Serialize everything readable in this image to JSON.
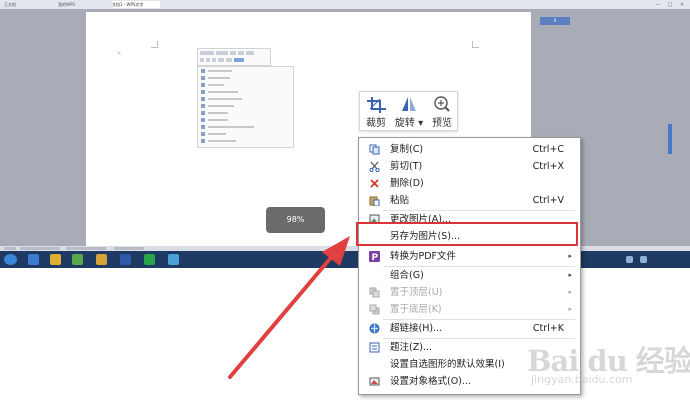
{
  "window": {
    "tabs": [
      "正文档",
      "我的WPS",
      "文档1 - WPS文字"
    ],
    "controls": [
      "—",
      "□",
      "✕"
    ]
  },
  "document": {
    "zoom_indicator": "98%"
  },
  "side_tag": "4",
  "picture_toolbar": {
    "items": [
      {
        "label": "裁剪",
        "icon": "crop-icon"
      },
      {
        "label": "旋转 ▾",
        "icon": "rotate-icon"
      },
      {
        "label": "预览",
        "icon": "zoom-preview-icon"
      }
    ]
  },
  "context_menu": {
    "items": [
      {
        "label": "复制(C)",
        "shortcut": "Ctrl+C",
        "icon": "copy-icon",
        "disabled": false,
        "submenu": false
      },
      {
        "label": "剪切(T)",
        "shortcut": "Ctrl+X",
        "icon": "scissors-icon",
        "disabled": false,
        "submenu": false
      },
      {
        "label": "删除(D)",
        "shortcut": "",
        "icon": "delete-icon",
        "disabled": false,
        "submenu": false
      },
      {
        "label": "粘贴",
        "shortcut": "Ctrl+V",
        "icon": "paste-icon",
        "disabled": false,
        "submenu": false
      },
      {
        "label": "更改图片(A)...",
        "shortcut": "",
        "icon": "change-picture-icon",
        "disabled": false,
        "submenu": false
      },
      {
        "label": "另存为图片(S)...",
        "shortcut": "",
        "icon": "",
        "disabled": false,
        "submenu": false
      },
      {
        "label": "转换为PDF文件",
        "shortcut": "",
        "icon": "pdf-icon",
        "disabled": false,
        "submenu": true
      },
      {
        "label": "组合(G)",
        "shortcut": "",
        "icon": "",
        "disabled": false,
        "submenu": true
      },
      {
        "label": "置于顶层(U)",
        "shortcut": "",
        "icon": "bring-to-front-icon",
        "disabled": true,
        "submenu": true
      },
      {
        "label": "置于底层(K)",
        "shortcut": "",
        "icon": "send-to-back-icon",
        "disabled": true,
        "submenu": true
      },
      {
        "label": "超链接(H)...",
        "shortcut": "Ctrl+K",
        "icon": "hyperlink-icon",
        "disabled": false,
        "submenu": false
      },
      {
        "label": "题注(Z)...",
        "shortcut": "",
        "icon": "caption-icon",
        "disabled": false,
        "submenu": false
      },
      {
        "label": "设置自选图形的默认效果(I)",
        "shortcut": "",
        "icon": "",
        "disabled": false,
        "submenu": false
      },
      {
        "label": "设置对象格式(O)...",
        "shortcut": "",
        "icon": "format-object-icon",
        "disabled": false,
        "submenu": false
      }
    ]
  },
  "watermark": {
    "main": "Bai du 经验",
    "sub": "jingyan.baidu.com"
  },
  "colors": {
    "highlight": "#d9343a",
    "arrow": "#e0403f",
    "workspace": "#a9acb7",
    "taskbar": "#1f3a62"
  }
}
